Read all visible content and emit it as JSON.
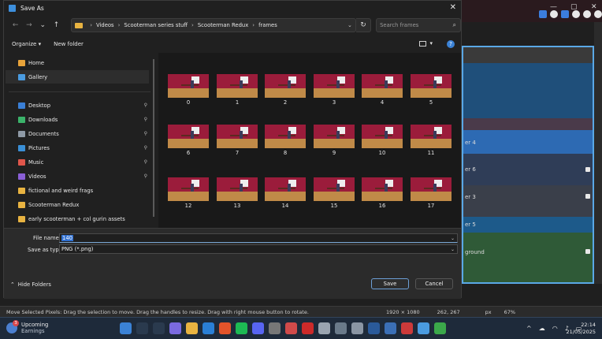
{
  "dialog": {
    "title": "Save As",
    "breadcrumb": [
      "Videos",
      "Scooterman series stuff",
      "Scooterman Redux",
      "frames"
    ],
    "search_placeholder": "Search frames",
    "organize_label": "Organize ▾",
    "new_folder_label": "New folder"
  },
  "sidebar": {
    "items": [
      {
        "label": "Home",
        "icon": "home-icon",
        "color": "#e8a33a",
        "pinned": false
      },
      {
        "label": "Gallery",
        "icon": "gallery-icon",
        "color": "#4a9be0",
        "pinned": false,
        "selected": true
      },
      {
        "label": "Desktop",
        "icon": "desktop-icon",
        "color": "#3a7fd6",
        "pinned": true
      },
      {
        "label": "Downloads",
        "icon": "download-icon",
        "color": "#3bb36a",
        "pinned": true
      },
      {
        "label": "Documents",
        "icon": "document-icon",
        "color": "#8f9aa6",
        "pinned": true
      },
      {
        "label": "Pictures",
        "icon": "pictures-icon",
        "color": "#3a8fd6",
        "pinned": true
      },
      {
        "label": "Music",
        "icon": "music-icon",
        "color": "#e0564b",
        "pinned": true
      },
      {
        "label": "Videos",
        "icon": "videos-icon",
        "color": "#8a5fd6",
        "pinned": true
      },
      {
        "label": "fictional and weird frags",
        "icon": "folder-icon",
        "color": "#e8b341",
        "pinned": false
      },
      {
        "label": "Scooterman Redux",
        "icon": "folder-icon",
        "color": "#e8b341",
        "pinned": false
      },
      {
        "label": "early scooterman + col gurin assets",
        "icon": "folder-icon",
        "color": "#e8b341",
        "pinned": false
      }
    ]
  },
  "files": [
    "0",
    "1",
    "2",
    "3",
    "4",
    "5",
    "6",
    "7",
    "8",
    "9",
    "10",
    "11",
    "12",
    "13",
    "14",
    "15",
    "16",
    "17"
  ],
  "form": {
    "file_name_label": "File name:",
    "file_name_value": "140",
    "save_type_label": "Save as type:",
    "save_type_value": "PNG (*.png)",
    "hide_folders_label": "Hide Folders",
    "save_label": "Save",
    "cancel_label": "Cancel"
  },
  "background": {
    "layers": [
      "er 4",
      "er 6",
      "er 3",
      "er 5",
      "ground"
    ],
    "status_text": "Move Selected Pixels: Drag the selection to move. Drag the handles to resize. Drag with right mouse button to rotate.",
    "canvas_size": "1920 × 1080",
    "cursor_pos": "262, 267",
    "unit": "px",
    "zoom": "67%"
  },
  "taskbar": {
    "weather_title": "Upcoming",
    "weather_sub": "Earnings",
    "badge": "3",
    "time": "22:14",
    "date": "21/05/2025"
  }
}
